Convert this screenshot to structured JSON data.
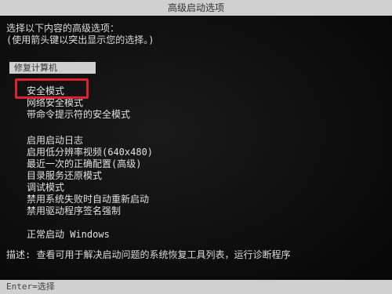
{
  "title": "高级启动选项",
  "intro": {
    "line1": "选择以下内容的高级选项：",
    "line2": "(使用箭头键以突出显示您的选择。)"
  },
  "repair_label": "修复计算机",
  "menu": {
    "group1": [
      "安全模式",
      "网络安全模式",
      "带命令提示符的安全模式"
    ],
    "group2": [
      "启用启动日志",
      "启用低分辨率视频(640x480)",
      "最近一次的正确配置(高级)",
      "目录服务还原模式",
      "调试模式",
      "禁用系统失败时自动重新启动",
      "禁用驱动程序签名强制"
    ],
    "group3": [
      "正常启动 Windows"
    ]
  },
  "description": "描述: 查看可用于解决启动问题的系统恢复工具列表，运行诊断程序",
  "footer": "Enter=选择",
  "colors": {
    "background": "#0c0c0c",
    "text": "#dcdcdc",
    "bar": "#cfcfcf",
    "highlight_box": "#e0202e"
  }
}
